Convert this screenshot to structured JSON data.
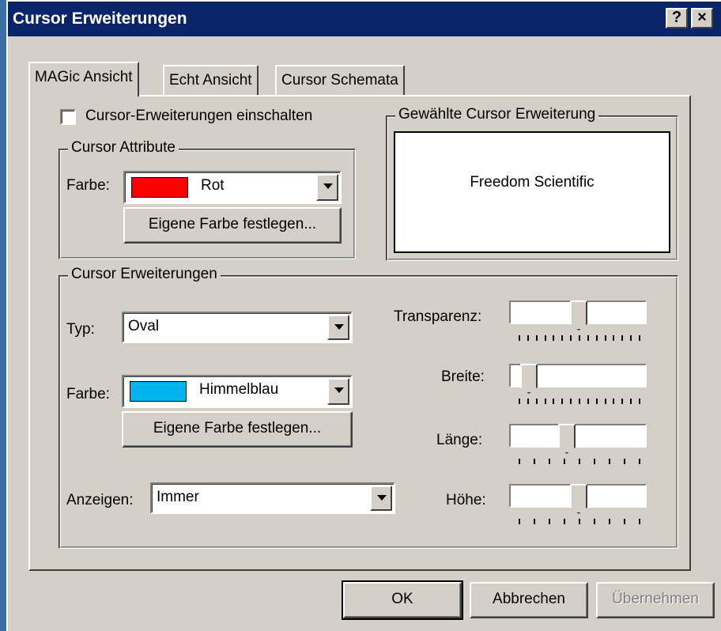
{
  "window": {
    "title": "Cursor Erweiterungen",
    "help_label": "?",
    "close_label": "×"
  },
  "tabs": [
    {
      "label": "MAGic Ansicht",
      "active": true
    },
    {
      "label": "Echt Ansicht",
      "active": false
    },
    {
      "label": "Cursor Schemata",
      "active": false
    }
  ],
  "enable_checkbox": {
    "label": "Cursor-Erweiterungen einschalten",
    "checked": false
  },
  "cursor_attribute": {
    "legend": "Cursor Attribute",
    "color_label": "Farbe:",
    "color_value": "Rot",
    "color_swatch": "#ff0000",
    "custom_button": "Eigene Farbe festlegen..."
  },
  "selected_extension": {
    "legend": "Gewählte Cursor Erweiterung",
    "preview_text": "Freedom  Scientific"
  },
  "extensions": {
    "legend": "Cursor Erweiterungen",
    "type_label": "Typ:",
    "type_value": "Oval",
    "color_label": "Farbe:",
    "color_value": "Himmelblau",
    "color_swatch": "#00b4f0",
    "custom_button": "Eigene Farbe festlegen...",
    "show_label": "Anzeigen:",
    "show_value": "Immer"
  },
  "sliders": [
    {
      "label": "Transparenz:",
      "level": 0.5,
      "ticks": 15
    },
    {
      "label": "Breite:",
      "level": 0.08,
      "ticks": 15
    },
    {
      "label": "Länge:",
      "level": 0.4,
      "ticks": 9
    },
    {
      "label": "Höhe:",
      "level": 0.5,
      "ticks": 9
    }
  ],
  "buttons": {
    "ok": "OK",
    "cancel": "Abbrechen",
    "apply": "Übernehmen"
  }
}
